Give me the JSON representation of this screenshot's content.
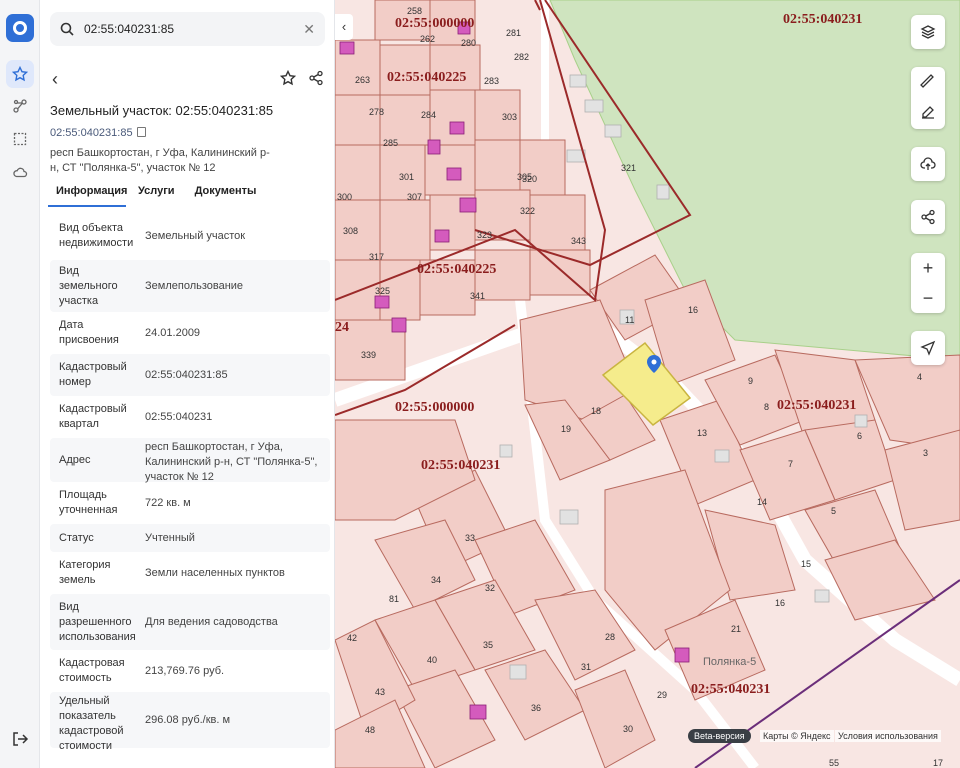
{
  "search": {
    "value": "02:55:040231:85"
  },
  "toolbar": {
    "back_icon": "chevron-left-icon",
    "favorite_icon": "star-icon",
    "share_icon": "share-icon"
  },
  "object": {
    "title": "Земельный участок: 02:55:040231:85",
    "cad_number": "02:55:040231:85",
    "address": "респ Башкортостан, г Уфа, Калининский р-н, СТ \"Полянка-5\", участок № 12"
  },
  "tabs": [
    "Информация",
    "Услуги",
    "Документы"
  ],
  "properties": [
    {
      "label": "Вид объекта недвижимости",
      "value": "Земельный участок"
    },
    {
      "label": "Вид земельного участка",
      "value": "Землепользование"
    },
    {
      "label": "Дата присвоения",
      "value": "24.01.2009"
    },
    {
      "label": "Кадастровый номер",
      "value": "02:55:040231:85"
    },
    {
      "label": "Кадастровый квартал",
      "value": "02:55:040231"
    },
    {
      "label": "Адрес",
      "value": "респ Башкортостан, г Уфа, Калининский р-н, СТ \"Полянка-5\", участок № 12"
    },
    {
      "label": "Площадь уточненная",
      "value": "722 кв. м"
    },
    {
      "label": "Статус",
      "value": "Учтенный"
    },
    {
      "label": "Категория земель",
      "value": "Земли населенных пунктов"
    },
    {
      "label": "Вид разрешенного использования",
      "value": "Для ведения садоводства"
    },
    {
      "label": "Кадастровая стоимость",
      "value": "213,769.76 руб."
    },
    {
      "label": "Удельный показатель кадастровой стоимости",
      "value": "296.08 руб./кв. м"
    }
  ],
  "map": {
    "quarters": [
      "02:55:000000",
      "02:55:040225",
      "02:55:040231",
      "02:55:040225",
      "02:55:000000",
      "02:55:040231",
      "02:55:040231",
      "02:55:040231",
      "24"
    ],
    "plots": [
      "258",
      "262",
      "280",
      "281",
      "282",
      "263",
      "283",
      "278",
      "284",
      "303",
      "285",
      "301",
      "307",
      "305",
      "320",
      "321",
      "300",
      "308",
      "317",
      "322",
      "323",
      "343",
      "325",
      "341",
      "339",
      "11",
      "16",
      "9",
      "4",
      "8",
      "6",
      "3",
      "18",
      "19",
      "13",
      "7",
      "14",
      "5",
      "33",
      "34",
      "32",
      "15",
      "16",
      "81",
      "28",
      "21",
      "42",
      "40",
      "35",
      "31",
      "29",
      "43",
      "36",
      "48",
      "30",
      "55",
      "17"
    ],
    "street": "Полянка-5"
  },
  "footer": {
    "beta": "Beta-версия",
    "copyright": "Карты © Яндекс",
    "terms": "Условия использования"
  },
  "colors": {
    "accent": "#2f6fd6",
    "selected_plot": "#f5ec8c",
    "boundary": "#9b2a2a",
    "forest": "#cfe4bf"
  }
}
